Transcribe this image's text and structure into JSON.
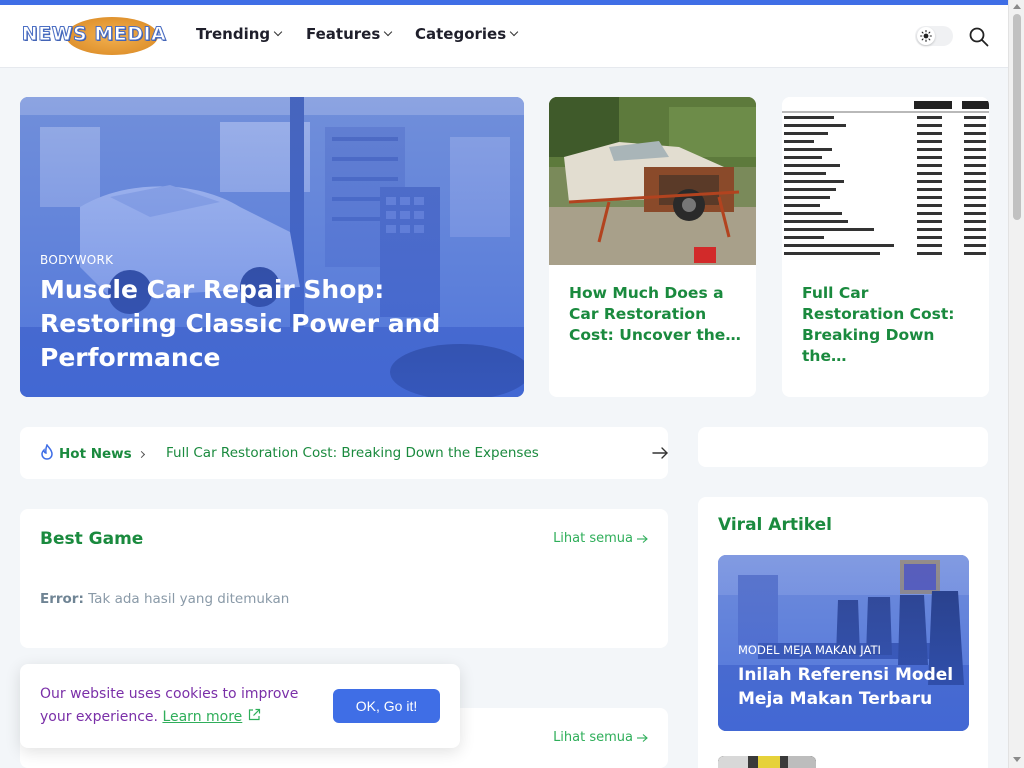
{
  "brand": {
    "logo_text": "NEWS MEDIA"
  },
  "nav": {
    "items": [
      {
        "label": "Trending"
      },
      {
        "label": "Features"
      },
      {
        "label": "Categories"
      }
    ]
  },
  "hero": {
    "category": "BODYWORK",
    "title": "Muscle Car Repair Shop: Restoring Classic Power and Performance"
  },
  "cards": [
    {
      "title": "How Much Does a Car Restoration Cost: Uncover the…"
    },
    {
      "title": "Full Car Restoration Cost: Breaking Down the…"
    }
  ],
  "hot_news": {
    "label": "Hot News",
    "headline": "Full Car Restoration Cost: Breaking Down the Expenses"
  },
  "best_game": {
    "title": "Best Game",
    "see_all": "Lihat semua",
    "error_label": "Error:",
    "error_text": "Tak ada hasil yang ditemukan"
  },
  "section2": {
    "see_all": "Lihat semua"
  },
  "viral": {
    "title": "Viral Artikel",
    "featured_category": "MODEL MEJA MAKAN JATI",
    "featured_title": "Inilah Referensi Model Meja Makan Terbaru"
  },
  "cookie": {
    "message": "Our website uses cookies to improve your experience.",
    "learn_more": "Learn more",
    "ok_label": "OK, Go it!"
  },
  "colors": {
    "accent": "#3f6ee6",
    "green": "#1a8a3e",
    "link_green": "#2fae5a",
    "cookie_text": "#7a2fa8"
  }
}
